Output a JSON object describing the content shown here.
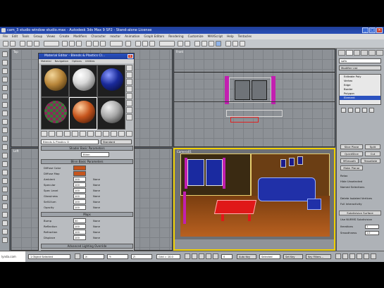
{
  "window": {
    "title": "cam_3 studio window studio.max - Autodesk 3ds Max 9 SP2 - Stand-alone License",
    "min_glyph": "_",
    "max_glyph": "□",
    "close_glyph": "×"
  },
  "menubar": [
    "File",
    "Edit",
    "Tools",
    "Group",
    "Views",
    "Create",
    "Modifiers",
    "Character",
    "reactor",
    "Animation",
    "Graph Editors",
    "Rendering",
    "Customize",
    "MAXScript",
    "Help",
    "Tentacles"
  ],
  "viewports": {
    "top": {
      "label": "Top"
    },
    "front": {
      "label": "Front"
    },
    "left": {
      "label": "Left"
    },
    "camera": {
      "label": "Camera01"
    }
  },
  "material_editor": {
    "title": "Material Editor - Blends & Plastics Cl...",
    "close_glyph": "×",
    "menu": [
      "Material",
      "Navigation",
      "Options",
      "Utilities"
    ],
    "slots": [
      {
        "name": "wood",
        "color": "#b8863a"
      },
      {
        "name": "chrome",
        "color": "#d8d8d8"
      },
      {
        "name": "blue-plastic",
        "color": "#1a2a9a"
      },
      {
        "name": "checker",
        "color": "#3a7a3a"
      },
      {
        "name": "orange-plastic",
        "color": "#c6551d"
      },
      {
        "name": "grey",
        "color": "#a8a8a8"
      }
    ],
    "material_name": "Blends & Plastics Cl",
    "material_type": "Standard",
    "rollouts": {
      "shader": "Shader Basic Parameters",
      "shader_type": "Blinn",
      "basic": "Blinn Basic Parameters",
      "extended": "Extended Parameters",
      "maps": "Maps",
      "lighting": "Advanced Lighting Override",
      "mental_ray": "mental ray Connection"
    },
    "params": [
      {
        "label": "Diffuse Color",
        "value": "",
        "note": ""
      },
      {
        "label": "Diffuse Map",
        "value": "",
        "note": ""
      },
      {
        "label": "Ambient",
        "value": "100",
        "note": "None"
      },
      {
        "label": "Specular",
        "value": "100",
        "note": "None"
      },
      {
        "label": "Spec Level",
        "value": "100",
        "note": "None"
      },
      {
        "label": "Glossiness",
        "value": "100",
        "note": "None"
      },
      {
        "label": "Self-Illum",
        "value": "100",
        "note": "None"
      },
      {
        "label": "Opacity",
        "value": "100",
        "note": "None"
      }
    ],
    "map_params": [
      {
        "label": "Bump",
        "value": "30",
        "note": "None"
      },
      {
        "label": "Reflection",
        "value": "100",
        "note": "None"
      },
      {
        "label": "Refraction",
        "value": "100",
        "note": "None"
      },
      {
        "label": "Displace",
        "value": "100",
        "note": "None"
      }
    ]
  },
  "command_panel": {
    "object_name": "sofa",
    "modifier_list": "Modifier List",
    "stack": [
      {
        "label": "Editable Poly",
        "selected": false
      },
      {
        "label": "Vertex",
        "selected": false
      },
      {
        "label": "Edge",
        "selected": false
      },
      {
        "label": "Border",
        "selected": false
      },
      {
        "label": "Polygon",
        "selected": false
      },
      {
        "label": "Element",
        "selected": true
      }
    ],
    "buttons": {
      "slice_plane": "Slice Plane",
      "split": "Split",
      "quick_slice": "QuickSlice",
      "cut": "Cut",
      "msmooth": "MSmooth",
      "tessellate": "Tessellate",
      "make_planar": "Make Planar"
    },
    "texts": {
      "relax": "Relax",
      "hide_unselected": "Hide Unselected",
      "named_selections": "Named Selections",
      "delete_isolated": "Delete Isolated Vertices",
      "full_interactivity": "Full Interactivity",
      "subdivision": "Subdivision Surface",
      "use_nurms": "Use NURMS Subdivision",
      "iterations": "Iterations",
      "smoothness": "Smoothness"
    },
    "spinners": {
      "iterations": "1",
      "smoothness": "1.0",
      "weight": "1.0"
    }
  },
  "statusbar": {
    "status": "1 Object Selected",
    "x": "X:",
    "y": "Y:",
    "z": "Z:",
    "grid": "Grid = 10.0",
    "auto_key": "Auto Key",
    "selected": "Selected",
    "set_key": "Set Key",
    "key_filters": "Key Filters...",
    "frame": "0"
  },
  "watermark": {
    "text": "lynda.com"
  }
}
